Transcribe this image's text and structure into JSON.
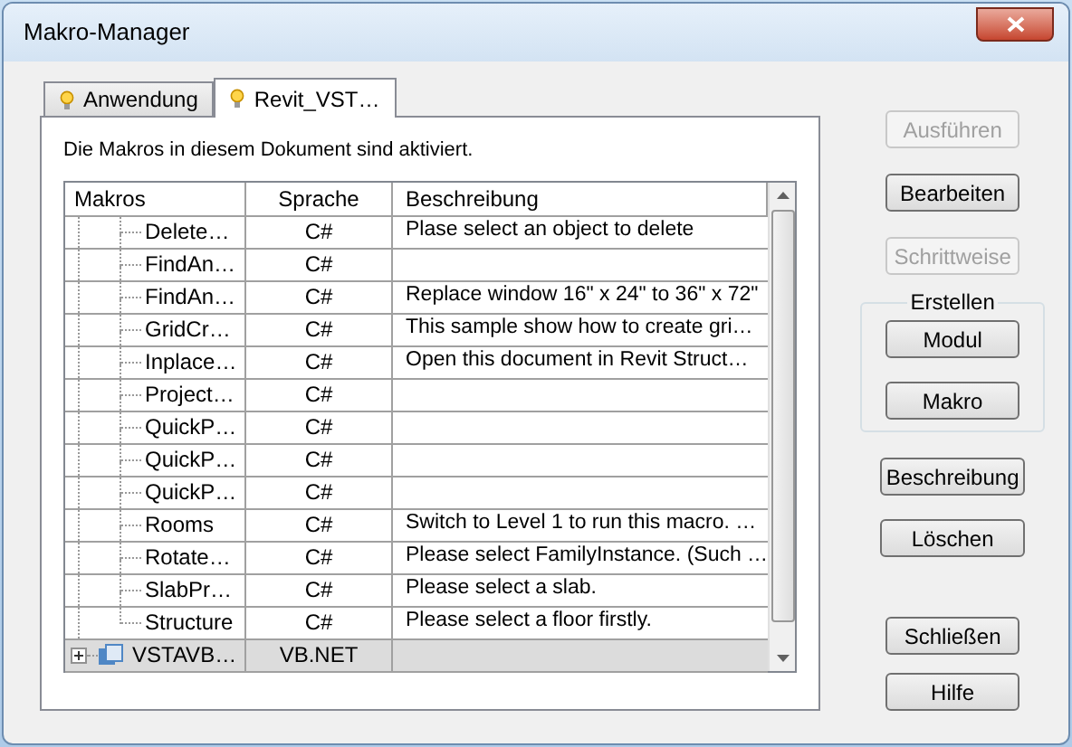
{
  "window": {
    "title": "Makro-Manager"
  },
  "tabs": [
    {
      "label": "Anwendung",
      "selected": false
    },
    {
      "label": "Revit_VST…",
      "selected": true
    }
  ],
  "info": "Die Makros in diesem Dokument sind aktiviert.",
  "table": {
    "columns": [
      "Makros",
      "Sprache",
      "Beschreibung"
    ],
    "rows": [
      {
        "kind": "macro",
        "name": "Delete…",
        "language": "C#",
        "description": "Plase select an object to delete",
        "selected": false
      },
      {
        "kind": "macro",
        "name": "FindAn…",
        "language": "C#",
        "description": "",
        "selected": false
      },
      {
        "kind": "macro",
        "name": "FindAn…",
        "language": "C#",
        "description": "Replace window 16\" x 24\" to 36\" x 72\"",
        "selected": false
      },
      {
        "kind": "macro",
        "name": "GridCr…",
        "language": "C#",
        "description": "This sample show how to create gri…",
        "selected": false
      },
      {
        "kind": "macro",
        "name": "Inplace…",
        "language": "C#",
        "description": "Open this document in Revit Struct…",
        "selected": false
      },
      {
        "kind": "macro",
        "name": "Project…",
        "language": "C#",
        "description": "",
        "selected": false
      },
      {
        "kind": "macro",
        "name": "QuickP…",
        "language": "C#",
        "description": "",
        "selected": false
      },
      {
        "kind": "macro",
        "name": "QuickP…",
        "language": "C#",
        "description": "",
        "selected": false
      },
      {
        "kind": "macro",
        "name": "QuickP…",
        "language": "C#",
        "description": "",
        "selected": false
      },
      {
        "kind": "macro",
        "name": "Rooms",
        "language": "C#",
        "description": "Switch to Level 1 to run this macro. …",
        "selected": false
      },
      {
        "kind": "macro",
        "name": "Rotate…",
        "language": "C#",
        "description": "Please select FamilyInstance. (Such …",
        "selected": false
      },
      {
        "kind": "macro",
        "name": "SlabPr…",
        "language": "C#",
        "description": "Please select a slab.",
        "selected": false
      },
      {
        "kind": "macro",
        "name": "Structure",
        "language": "C#",
        "description": "Please select a floor firstly.",
        "selected": false
      },
      {
        "kind": "module",
        "name": "VSTAVB…",
        "language": "VB.NET",
        "description": "",
        "selected": true,
        "expanded": false
      }
    ]
  },
  "buttons": [
    {
      "label": "Ausführen",
      "disabled": true
    },
    {
      "label": "Bearbeiten",
      "disabled": false
    },
    {
      "label": "Schrittweise",
      "disabled": true
    }
  ],
  "create_group": {
    "title": "Erstellen",
    "buttons": [
      {
        "label": "Modul",
        "disabled": false
      },
      {
        "label": "Makro",
        "disabled": false
      }
    ]
  },
  "buttons_lower": [
    {
      "label": "Beschreibung",
      "disabled": false
    },
    {
      "label": "Löschen",
      "disabled": false
    }
  ],
  "buttons_bottom": [
    {
      "label": "Schließen",
      "disabled": false
    },
    {
      "label": "Hilfe",
      "disabled": false
    }
  ]
}
